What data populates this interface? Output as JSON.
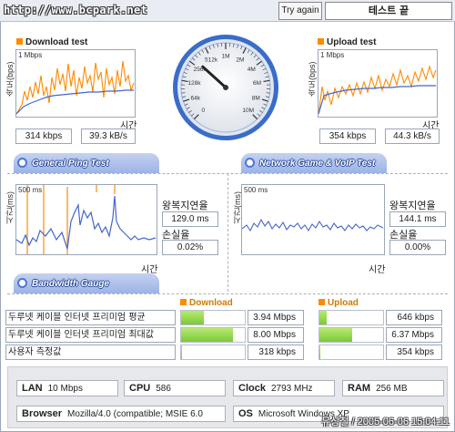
{
  "header": {
    "site_label": "http://www.bcpark.net",
    "try_again_label": "Try again",
    "status_text": "테스트 끝"
  },
  "download": {
    "title": "Download test",
    "y_label": "속도(bps)",
    "scale_label": "1 Mbps",
    "x_label": "시간",
    "speed": "314 kbps",
    "rate": "39.3 kB/s"
  },
  "upload": {
    "title": "Upload test",
    "y_label": "속도(bps)",
    "scale_label": "1 Mbps",
    "x_label": "시간",
    "speed": "354 kbps",
    "rate": "44.3 kB/s"
  },
  "gauge": {
    "needle_value_kbps": 314,
    "ticks": [
      "0",
      "64k",
      "128k",
      "256k",
      "512k",
      "1M",
      "2M",
      "4M",
      "6M",
      "8M",
      "10M"
    ]
  },
  "tabs": {
    "general_ping": "General Ping Test",
    "network_game": "Network Game & VoIP Test",
    "bandwidth_gauge": "Bandwidth Gauge"
  },
  "ping_general": {
    "y_label": "시간(ms)",
    "scale_label": "500 ms",
    "x_label": "시간",
    "rtt_label": "왕복지연율",
    "rtt_value": "129.0 ms",
    "loss_label": "손실율",
    "loss_value": "0.02%"
  },
  "ping_game": {
    "y_label": "시간(ms)",
    "scale_label": "500 ms",
    "x_label": "시간",
    "rtt_label": "왕복지연율",
    "rtt_value": "144.1 ms",
    "loss_label": "손실율",
    "loss_value": "0.00%"
  },
  "bandwidth": {
    "download_header": "Download",
    "upload_header": "Upload",
    "rows": [
      {
        "name": "두루넷 케이블 인터넷 프리미엄 평균",
        "down": "3.94 Mbps",
        "down_fraction": 0.35,
        "up": "646 kbps",
        "up_fraction": 0.12
      },
      {
        "name": "두루넷 케이블 인터넷 프리미엄 최대값",
        "down": "8.00 Mbps",
        "down_fraction": 0.82,
        "up": "6.37 Mbps",
        "up_fraction": 0.52
      },
      {
        "name": "사용자 측정값",
        "down": "318 kbps",
        "down_fraction": 0.02,
        "up": "354 kbps",
        "up_fraction": 0.02
      }
    ]
  },
  "system": {
    "lan_label": "LAN",
    "lan_value": "10 Mbps",
    "cpu_label": "CPU",
    "cpu_value": "586",
    "clock_label": "Clock",
    "clock_value": "2793 MHz",
    "ram_label": "RAM",
    "ram_value": "256 MB",
    "browser_label": "Browser",
    "browser_value": "Mozilla/4.0 (compatible; MSIE 6.0",
    "os_label": "OS",
    "os_value": "Microsoft Windows XP"
  },
  "footer": {
    "text": "유상철 / 2005-06-06 15:04:11"
  },
  "colors": {
    "series_orange": "#ff8a00",
    "series_blue": "#4466cc",
    "bar_green": "#7cc83a",
    "tab_blue": "#9db3e6"
  }
}
